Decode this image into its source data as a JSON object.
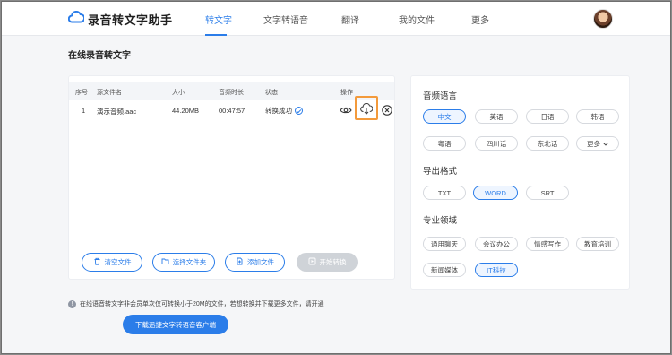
{
  "nav": {
    "logo_text": "录音转文字助手",
    "items": [
      "转文字",
      "文字转语音",
      "翻译",
      "我的文件",
      "更多"
    ]
  },
  "page_title": "在线录音转文字",
  "table": {
    "headers": [
      "序号",
      "源文件名",
      "大小",
      "音频时长",
      "状态",
      "操作"
    ],
    "rows": [
      {
        "index": "1",
        "name": "演示音频.aac",
        "size": "44.20MB",
        "duration": "00:47:57",
        "status": "转换成功"
      }
    ]
  },
  "buttons": {
    "clear": "清空文件",
    "choose_folder": "选择文件夹",
    "add_file": "添加文件",
    "start": "开始转换"
  },
  "notice": "在线语音转文字非会员单次仅可转换小于20M的文件，若想转换并下载更多文件，请开通",
  "download_client": "下载迅捷文字转语音客户端",
  "settings": {
    "language_title": "音频语言",
    "languages": [
      "中文",
      "英语",
      "日语",
      "韩语",
      "粤语",
      "四川话",
      "东北话",
      "更多"
    ],
    "selected_language": "中文",
    "format_title": "导出格式",
    "formats": [
      "TXT",
      "WORD",
      "SRT"
    ],
    "selected_format": "WORD",
    "domain_title": "专业领域",
    "domains": [
      "通用聊天",
      "会议办公",
      "情感写作",
      "教育培训",
      "新闻媒体",
      "IT科技"
    ],
    "selected_domain": "IT科技"
  },
  "colors": {
    "accent": "#2b7de9",
    "highlight": "#f39a3b",
    "disabled": "#cfd3d8"
  },
  "icons": [
    "cloud-logo-icon",
    "eye-icon",
    "download-cloud-icon",
    "close-circle-icon",
    "check-circle-icon",
    "trash-icon",
    "folder-icon",
    "file-add-icon",
    "start-icon",
    "info-icon",
    "chevron-down-icon"
  ]
}
